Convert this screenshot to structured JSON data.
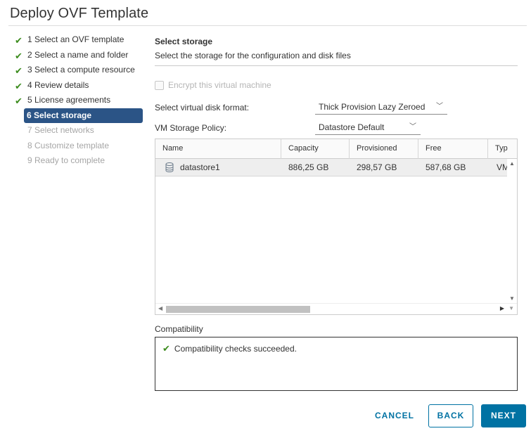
{
  "window": {
    "title": "Deploy OVF Template"
  },
  "steps": [
    {
      "label": "1 Select an OVF template",
      "state": "done"
    },
    {
      "label": "2 Select a name and folder",
      "state": "done"
    },
    {
      "label": "3 Select a compute resource",
      "state": "done"
    },
    {
      "label": "4 Review details",
      "state": "done"
    },
    {
      "label": "5 License agreements",
      "state": "done"
    },
    {
      "label": "6 Select storage",
      "state": "active"
    },
    {
      "label": "7 Select networks",
      "state": "disabled"
    },
    {
      "label": "8 Customize template",
      "state": "disabled"
    },
    {
      "label": "9 Ready to complete",
      "state": "disabled"
    }
  ],
  "section": {
    "title": "Select storage",
    "subtitle": "Select the storage for the configuration and disk files"
  },
  "encrypt": {
    "label": "Encrypt this virtual machine",
    "checked": false,
    "enabled": false
  },
  "disk_format": {
    "label": "Select virtual disk format:",
    "value": "Thick Provision Lazy Zeroed"
  },
  "storage_policy": {
    "label": "VM Storage Policy:",
    "value": "Datastore Default"
  },
  "table": {
    "columns": [
      "Name",
      "Capacity",
      "Provisioned",
      "Free",
      "Typ"
    ],
    "rows": [
      {
        "name": "datastore1",
        "capacity": "886,25 GB",
        "provisioned": "298,57 GB",
        "free": "587,68 GB",
        "type": "VM"
      }
    ]
  },
  "compatibility": {
    "label": "Compatibility",
    "message": "Compatibility checks succeeded."
  },
  "buttons": {
    "cancel": "CANCEL",
    "back": "BACK",
    "next": "NEXT"
  },
  "colors": {
    "accent": "#0072a3",
    "active_step": "#2b5486",
    "success": "#3c8c1e"
  }
}
